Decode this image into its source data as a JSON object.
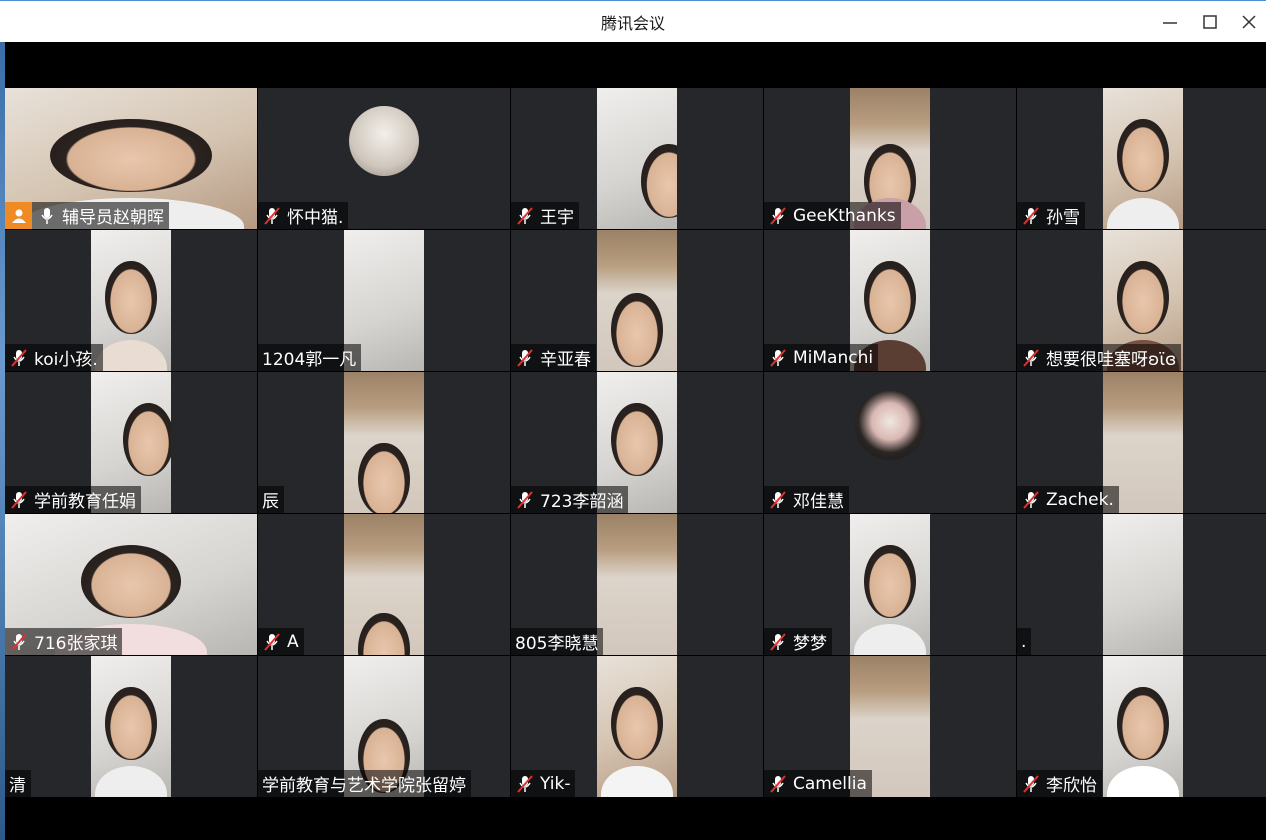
{
  "window": {
    "title": "腾讯会议",
    "minimize_icon": "minimize-icon",
    "maximize_icon": "maximize-icon",
    "close_icon": "close-icon"
  },
  "colors": {
    "tile_bg": "#25272b",
    "host_badge": "#f08a24",
    "label_bg": "rgba(0,0,0,0.55)"
  },
  "participants": [
    {
      "name": "辅导员赵朝晖",
      "host": true,
      "mic": "on"
    },
    {
      "name": "怀中猫.",
      "mic": "muted"
    },
    {
      "name": "王宇",
      "mic": "muted"
    },
    {
      "name": "GeeKthanks",
      "mic": "muted"
    },
    {
      "name": "孙雪",
      "mic": "muted"
    },
    {
      "name": "koi小孩.",
      "mic": "muted"
    },
    {
      "name": "1204郭一凡",
      "mic": "none"
    },
    {
      "name": "辛亚春",
      "mic": "muted"
    },
    {
      "name": "MiManchi",
      "mic": "muted"
    },
    {
      "name": "想要很哇塞呀ʚϊɞ",
      "mic": "muted"
    },
    {
      "name": "学前教育任娟",
      "mic": "muted"
    },
    {
      "name": "辰",
      "mic": "none"
    },
    {
      "name": "723李韶涵",
      "mic": "muted"
    },
    {
      "name": "邓佳慧",
      "mic": "muted"
    },
    {
      "name": "Zachek.",
      "mic": "muted"
    },
    {
      "name": "716张家琪",
      "mic": "muted"
    },
    {
      "name": "A",
      "mic": "muted"
    },
    {
      "name": "805李晓慧",
      "mic": "none"
    },
    {
      "name": "梦梦",
      "mic": "muted"
    },
    {
      "name": ".",
      "mic": "none"
    },
    {
      "name": "清",
      "mic": "none"
    },
    {
      "name": "学前教育与艺术学院张留婷",
      "mic": "none"
    },
    {
      "name": "Yik-",
      "mic": "muted"
    },
    {
      "name": "Camellia",
      "mic": "muted"
    },
    {
      "name": "李欣怡",
      "mic": "muted"
    }
  ]
}
